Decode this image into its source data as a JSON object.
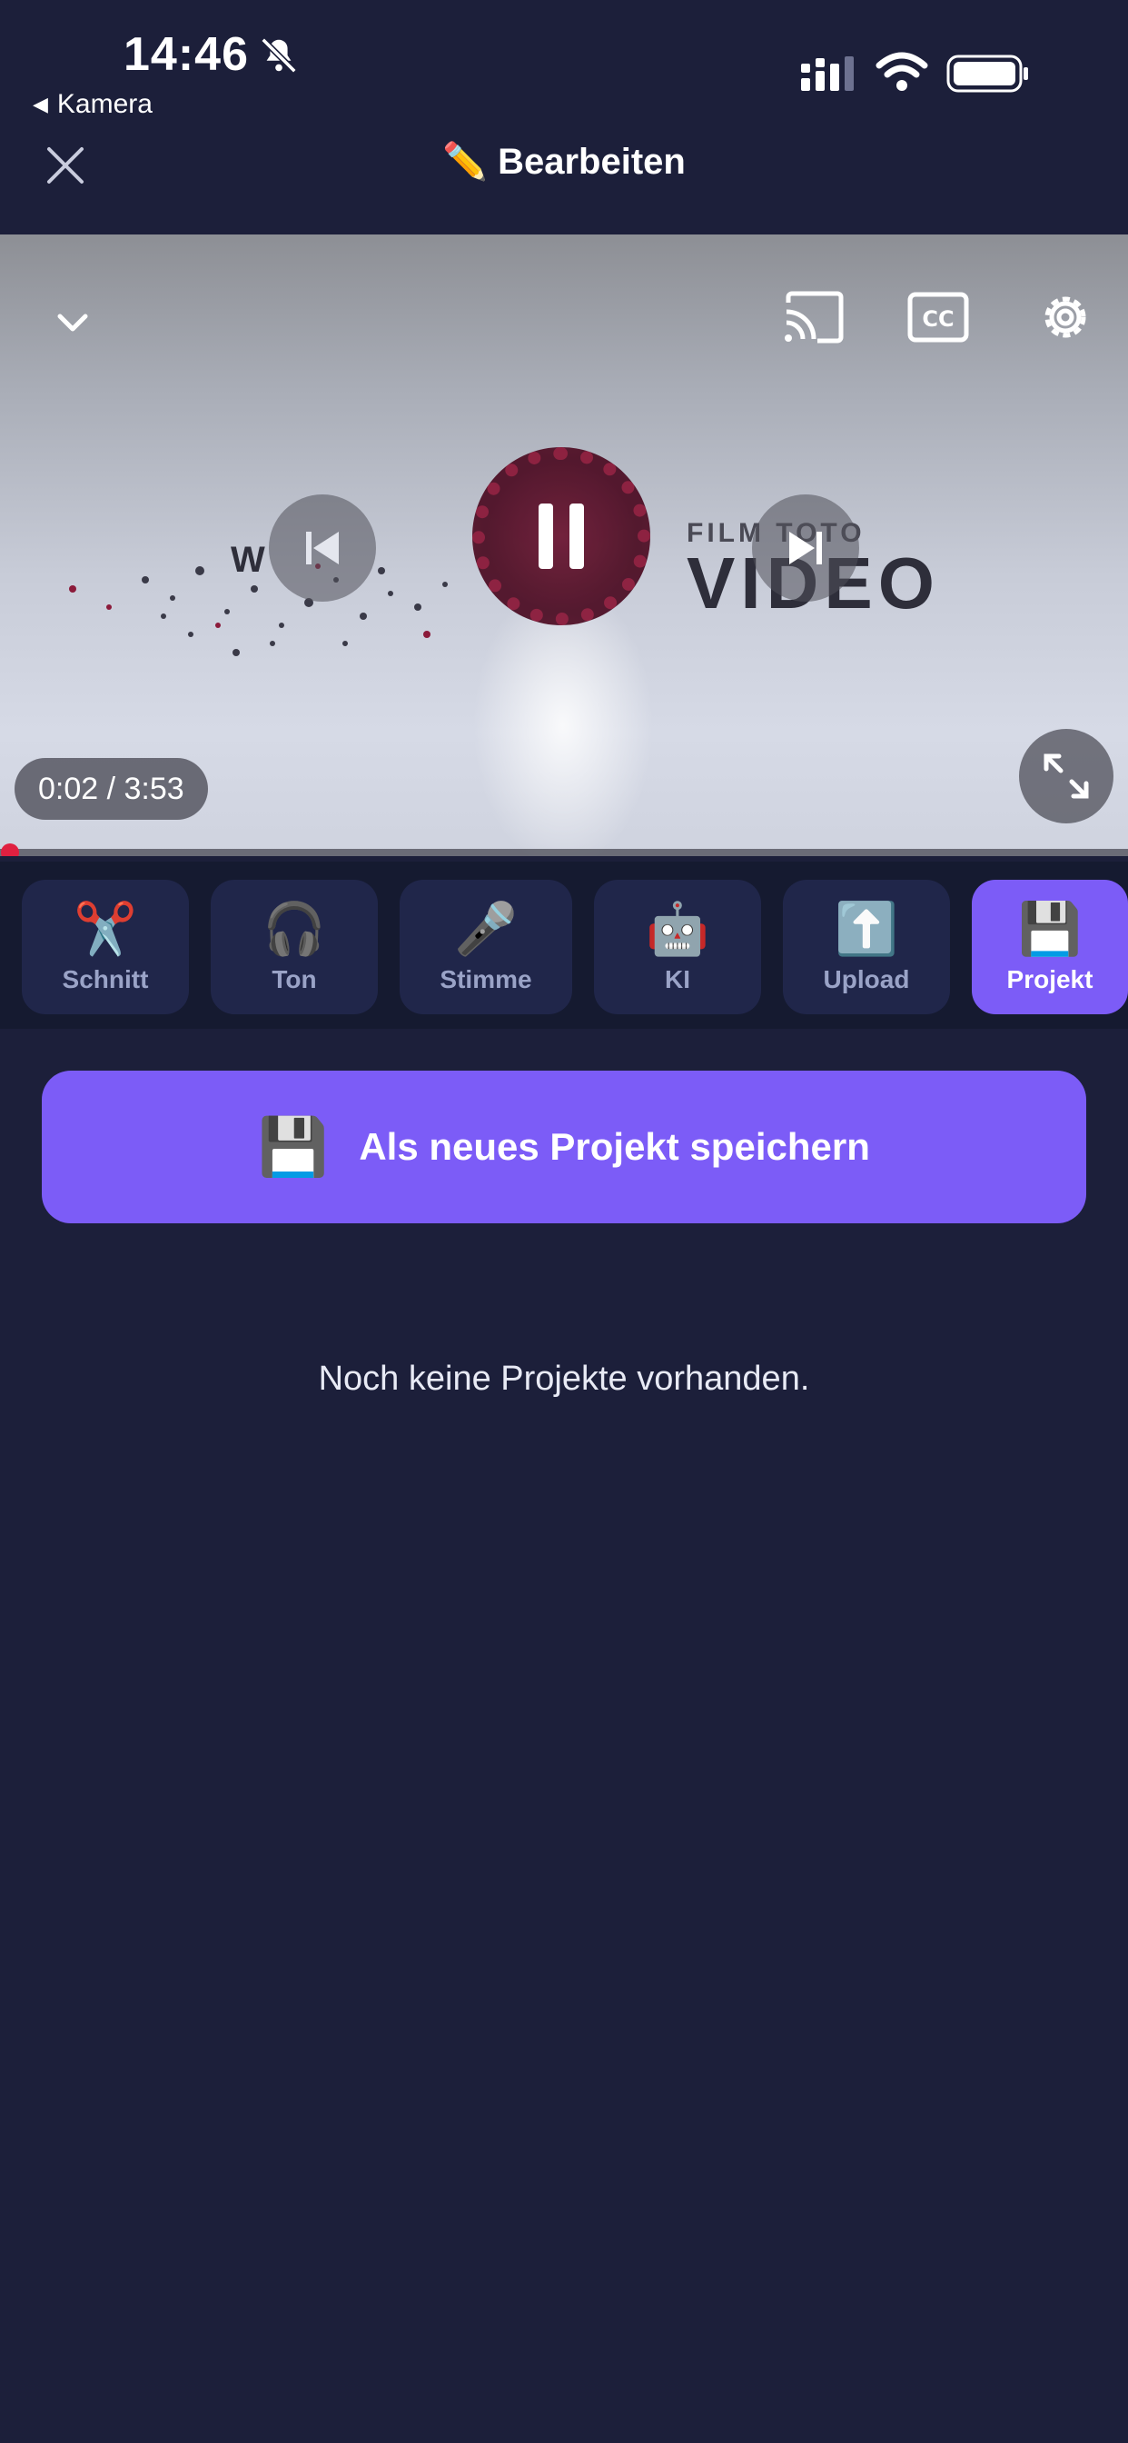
{
  "status_bar": {
    "time": "14:46",
    "back_app_label": "Kamera",
    "icons": [
      "bell-slash-icon",
      "signal-icon",
      "wifi-icon",
      "battery-icon"
    ]
  },
  "header": {
    "title": "✏️ Bearbeiten",
    "close_icon": "close-icon"
  },
  "video": {
    "brand_small": "FILM TOTO",
    "brand_big": "VIDEO",
    "brand_left": "W",
    "time_display": "0:02 / 3:53",
    "progress_fraction": 0.009,
    "controls": [
      "chevron-down-icon",
      "cast-icon",
      "closed-captions-icon",
      "gear-icon",
      "skip-previous-icon",
      "pause-icon",
      "skip-next-icon",
      "fullscreen-icon"
    ]
  },
  "tabs": [
    {
      "emoji": "✂️",
      "label": "Schnitt",
      "active": false
    },
    {
      "emoji": "🎧",
      "label": "Ton",
      "active": false
    },
    {
      "emoji": "🎤",
      "label": "Stimme",
      "active": false
    },
    {
      "emoji": "🤖",
      "label": "KI",
      "active": false
    },
    {
      "emoji": "⬆️",
      "label": "Upload",
      "active": false
    },
    {
      "emoji": "💾",
      "label": "Projekt",
      "active": true
    }
  ],
  "project": {
    "save_emoji": "💾",
    "save_label": "Als neues Projekt speichern",
    "empty_message": "Noch keine Projekte vorhanden."
  },
  "colors": {
    "background": "#1c1f3a",
    "tab_bar": "#151a30",
    "tab": "#20264a",
    "accent": "#7c5cf7",
    "progress": "#e02040"
  }
}
